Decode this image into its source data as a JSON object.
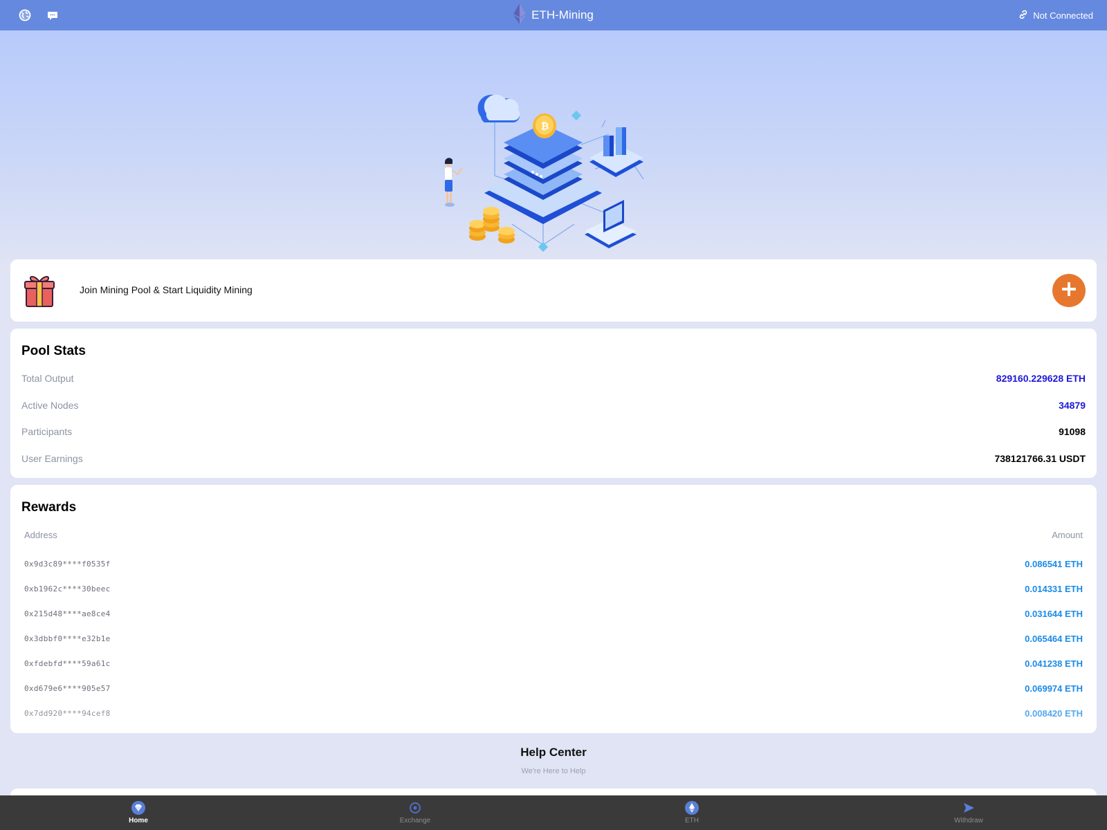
{
  "header": {
    "title": "ETH-Mining",
    "connection_status": "Not Connected",
    "icons": [
      "globe-icon",
      "chat-icon",
      "ethereum-logo-icon",
      "link-icon"
    ]
  },
  "join": {
    "text": "Join Mining Pool & Start Liquidity Mining",
    "icons": [
      "gift-icon",
      "plus-icon"
    ]
  },
  "pool_stats": {
    "title": "Pool Stats",
    "rows": [
      {
        "label": "Total Output",
        "value": "829160.229628 ETH"
      },
      {
        "label": "Active Nodes",
        "value": "34879"
      },
      {
        "label": "Participants",
        "value": "91098"
      },
      {
        "label": "User Earnings",
        "value": "738121766.31 USDT"
      }
    ]
  },
  "rewards": {
    "title": "Rewards",
    "col_address": "Address",
    "col_amount": "Amount",
    "rows": [
      {
        "address": "0x9d3c89****f0535f",
        "amount": "0.086541 ETH"
      },
      {
        "address": "0xb1962c****30beec",
        "amount": "0.014331 ETH"
      },
      {
        "address": "0x215d48****ae8ce4",
        "amount": "0.031644 ETH"
      },
      {
        "address": "0x3dbbf0****e32b1e",
        "amount": "0.065464 ETH"
      },
      {
        "address": "0xfdebfd****59a61c",
        "amount": "0.041238 ETH"
      },
      {
        "address": "0xd679e6****905e57",
        "amount": "0.069974 ETH"
      },
      {
        "address": "0x7dd920****94cef8",
        "amount": "0.008420 ETH"
      }
    ]
  },
  "help": {
    "title": "Help Center",
    "subtitle": "We're Here to Help"
  },
  "bottom_nav": [
    {
      "label": "Home",
      "icon": "diamond-icon",
      "active": true
    },
    {
      "label": "Exchange",
      "icon": "exchange-icon",
      "active": false
    },
    {
      "label": "ETH",
      "icon": "ethereum-icon",
      "active": false
    },
    {
      "label": "Withdraw",
      "icon": "send-icon",
      "active": false
    }
  ],
  "colors": {
    "header_bg": "#6589de",
    "accent_orange": "#e7772e",
    "stat_blue": "#1f17d8",
    "reward_blue": "#1a8ae8",
    "nav_bg": "#3a3a3a"
  }
}
